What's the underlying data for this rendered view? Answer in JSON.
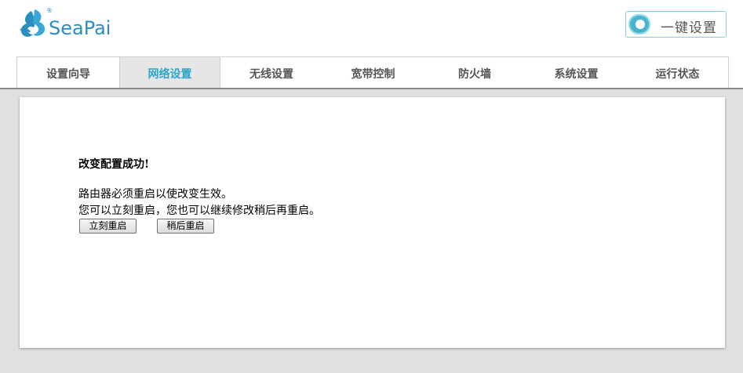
{
  "brand": {
    "logo_text": "SeaPai",
    "logo_icon": "seapai-seahorse-logo",
    "registered_mark": "®",
    "accent_color": "#2aa6cb"
  },
  "header": {
    "one_click_label": "一键设置",
    "one_click_icon": "toggle-switch-icon"
  },
  "nav": {
    "active": "网络设置",
    "tabs": [
      {
        "label": "设置向导"
      },
      {
        "label": "网络设置"
      },
      {
        "label": "无线设置"
      },
      {
        "label": "宽带控制"
      },
      {
        "label": "防火墙"
      },
      {
        "label": "系统设置"
      },
      {
        "label": "运行状态"
      }
    ]
  },
  "main": {
    "title": "改变配置成功!",
    "line1": "路由器必须重启以使改变生效。",
    "line2": "您可以立刻重启，您也可以继续修改稍后再重启。",
    "restart_now_label": "立刻重启",
    "restart_later_label": "稍后重启"
  }
}
